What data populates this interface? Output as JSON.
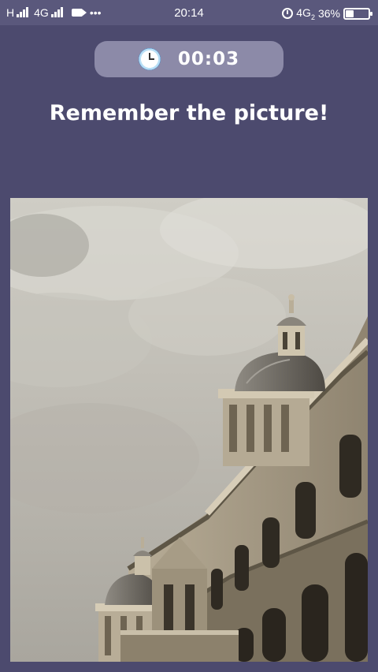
{
  "status_bar": {
    "network_left": "H",
    "network_4g": "4G",
    "dots": "•••",
    "time": "20:14",
    "network_right": "4G",
    "network_right_sub": "2",
    "battery_percent": "36%"
  },
  "timer": {
    "icon": "stopwatch-icon",
    "value": "00:03"
  },
  "heading": "Remember the picture!",
  "picture": {
    "subject": "domed-building-photo"
  },
  "colors": {
    "background": "#4c4a6e",
    "status_bar": "#5a587c",
    "timer_pill": "#8c8aa8",
    "text": "#ffffff"
  }
}
